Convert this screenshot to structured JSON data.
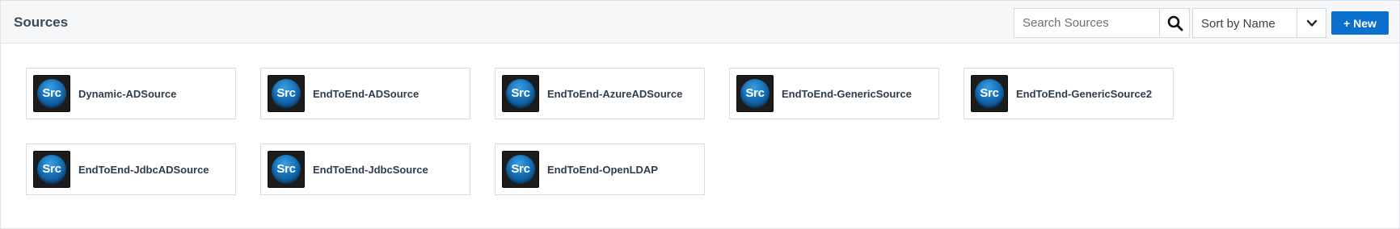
{
  "header": {
    "title": "Sources",
    "search_placeholder": "Search Sources",
    "search_value": "",
    "sort_selected": "Sort by Name",
    "new_label": "+ New"
  },
  "icons": {
    "search": "search-icon",
    "sort_chevron": "chevron-down-icon",
    "source": "source-icon"
  },
  "source_icon_text": "Src",
  "colors": {
    "accent": "#0b6fce",
    "title_text": "#3b4a5a",
    "icon_orb": "#1670b8",
    "icon_background": "#1c1c1c"
  },
  "sources": [
    {
      "label": "Dynamic-ADSource"
    },
    {
      "label": "EndToEnd-ADSource"
    },
    {
      "label": "EndToEnd-AzureADSource"
    },
    {
      "label": "EndToEnd-GenericSource"
    },
    {
      "label": "EndToEnd-GenericSource2"
    },
    {
      "label": "EndToEnd-JdbcADSource"
    },
    {
      "label": "EndToEnd-JdbcSource"
    },
    {
      "label": "EndToEnd-OpenLDAP"
    }
  ]
}
